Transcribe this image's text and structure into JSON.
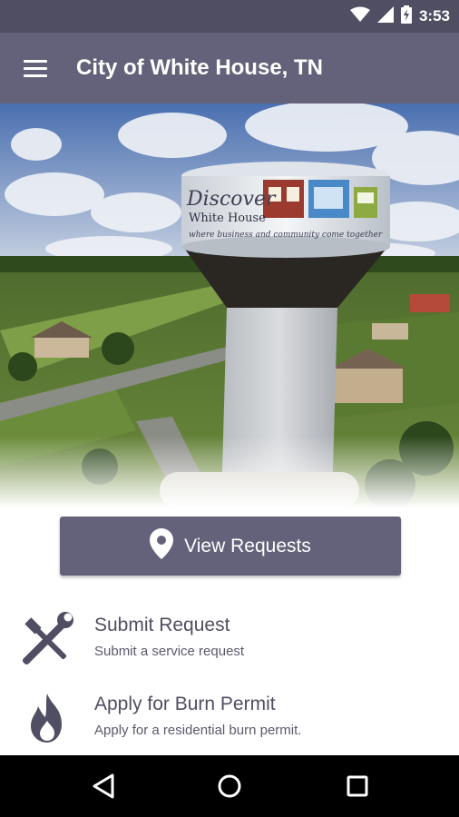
{
  "status_bar": {
    "time": "3:53",
    "icons": [
      "wifi-icon",
      "cell-signal-icon",
      "battery-charging-icon"
    ]
  },
  "app_bar": {
    "menu_icon": "hamburger-menu-icon",
    "title": "City of White House, TN"
  },
  "hero": {
    "sign_text": {
      "script": "Discover",
      "name": "White House",
      "tagline": "where business and community come together"
    }
  },
  "primary_action": {
    "icon": "map-pin-icon",
    "label": "View Requests"
  },
  "menu_items": [
    {
      "icon": "tools-icon",
      "title": "Submit Request",
      "subtitle": "Submit a service request"
    },
    {
      "icon": "fire-icon",
      "title": "Apply for Burn Permit",
      "subtitle": "Apply for a residential burn permit."
    }
  ],
  "nav_bar": {
    "icons": [
      "back-icon",
      "home-icon",
      "recents-icon"
    ]
  },
  "colors": {
    "status_bar": "#4f4e63",
    "app_bar": "#63627a",
    "accent": "#63627a",
    "text": "#4f4e63"
  }
}
